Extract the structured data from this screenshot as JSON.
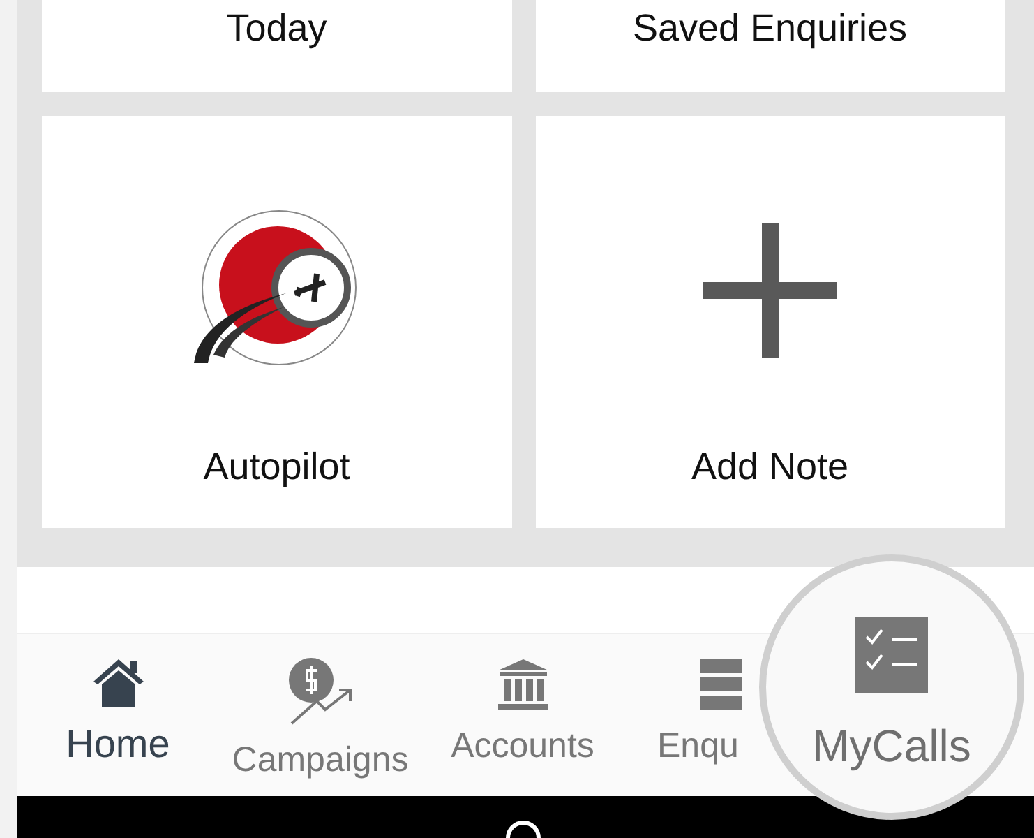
{
  "tiles": [
    {
      "label": "Today",
      "kind": "text"
    },
    {
      "label": "Saved Enquiries",
      "kind": "text"
    },
    {
      "label": "Autopilot",
      "kind": "logo"
    },
    {
      "label": "Add Note",
      "kind": "plus"
    }
  ],
  "bottom_nav": [
    {
      "label": "Home",
      "selected": true
    },
    {
      "label": "Campaigns",
      "selected": false
    },
    {
      "label": "Accounts",
      "selected": false
    },
    {
      "label": "Enqu",
      "selected": false
    }
  ],
  "magnifier": {
    "label": "MyCalls"
  }
}
